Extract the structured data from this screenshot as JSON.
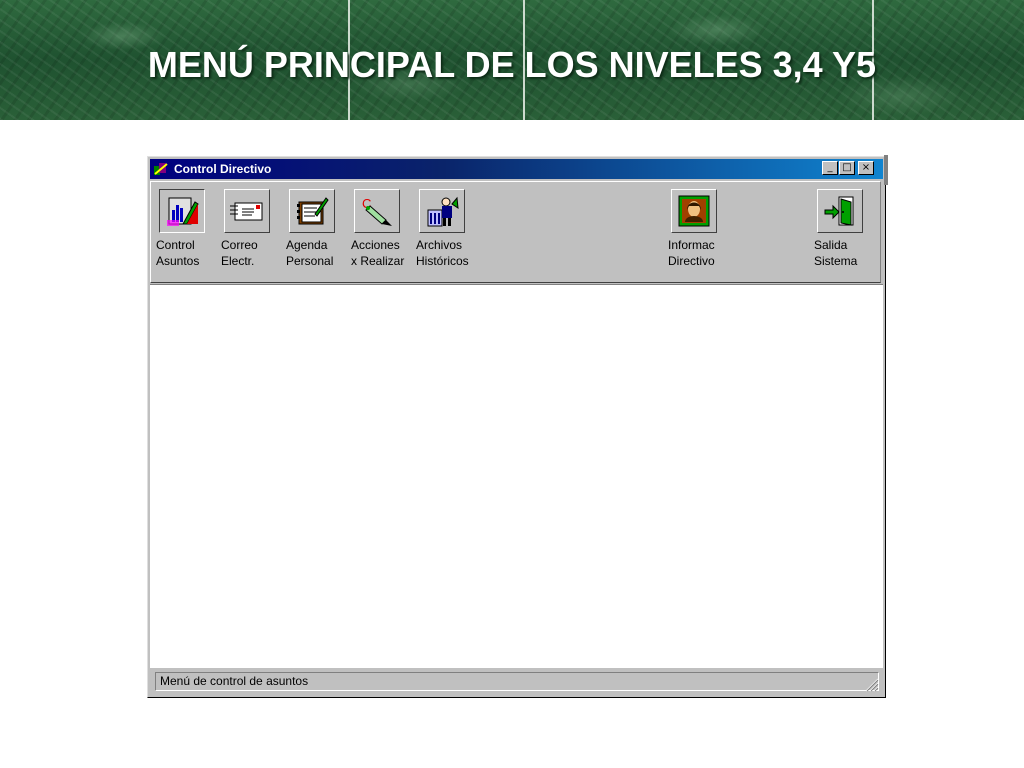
{
  "slide": {
    "title": "MENÚ PRINCIPAL DE LOS NIVELES 3,4 Y5"
  },
  "window": {
    "title": "Control Directivo",
    "icon": "app-icon",
    "controls": {
      "minimize": "_",
      "maximize": "□",
      "close": "×"
    }
  },
  "toolbar": {
    "items": [
      {
        "line1": "Control",
        "line2": "Asuntos",
        "icon": "chart-folder-icon",
        "pressed": true
      },
      {
        "line1": "Correo",
        "line2": "Electr.",
        "icon": "mail-envelope-icon",
        "pressed": false
      },
      {
        "line1": "Agenda",
        "line2": "Personal",
        "icon": "agenda-book-icon",
        "pressed": false
      },
      {
        "line1": "Acciones",
        "line2": "x Realizar",
        "icon": "marker-pen-icon",
        "pressed": false
      },
      {
        "line1": "Archivos",
        "line2": "Históricos",
        "icon": "archive-building-icon",
        "pressed": false
      },
      {
        "line1": "Informac",
        "line2": "Directivo",
        "icon": "portrait-icon",
        "pressed": false
      },
      {
        "line1": "Salida",
        "line2": "Sistema",
        "icon": "exit-door-icon",
        "pressed": false
      }
    ]
  },
  "statusbar": {
    "text": "Menú de control de asuntos"
  }
}
